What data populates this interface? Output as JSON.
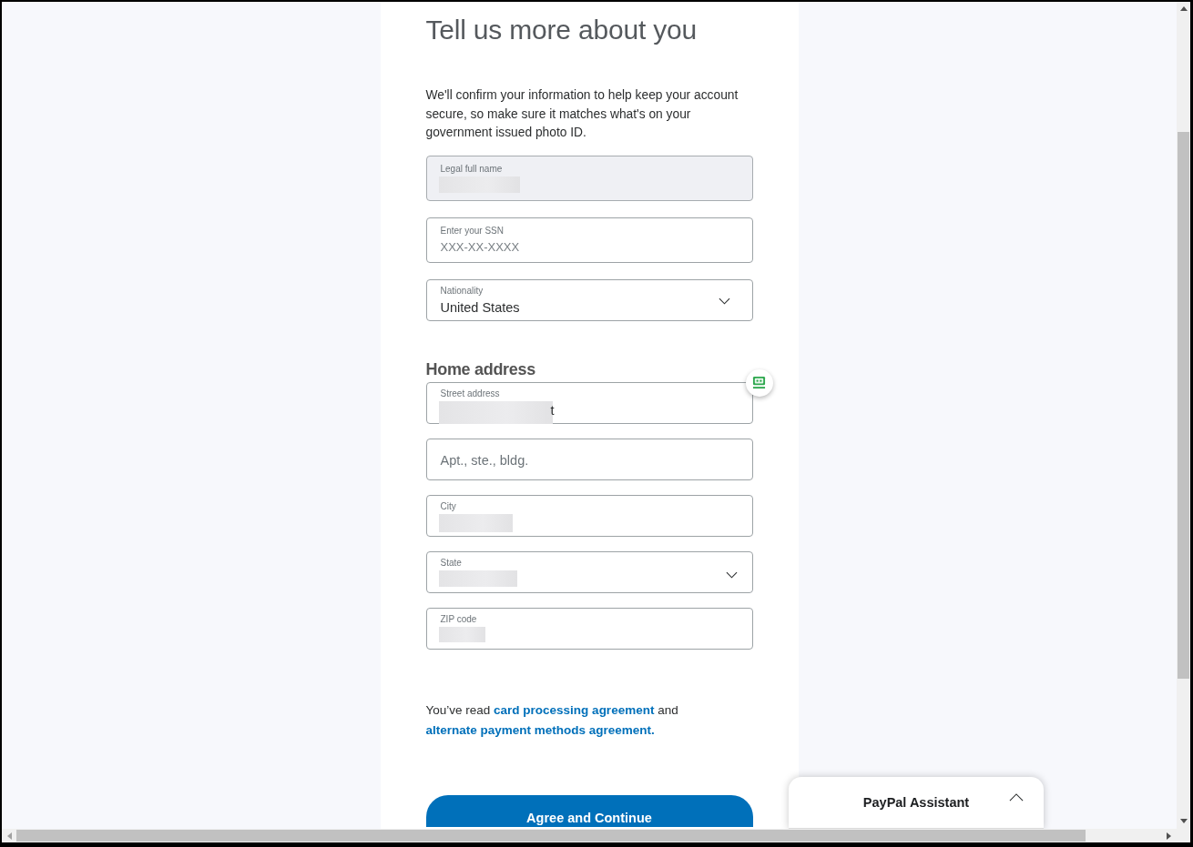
{
  "heading": "Tell us more about you",
  "intro": "We'll confirm your information to help keep your account secure, so make sure it matches what's on your government issued photo ID.",
  "identity_fields": [
    {
      "kind": "text",
      "label": "Legal full name",
      "redacted": true,
      "disabled": true
    },
    {
      "kind": "text",
      "label": "Enter your SSN",
      "placeholder": "XXX-XX-XXXX",
      "redacted": false,
      "disabled": false
    },
    {
      "kind": "select",
      "label": "Nationality",
      "value": "United States",
      "redacted": false,
      "disabled": false
    }
  ],
  "home_address": {
    "title": "Home address",
    "fields": [
      {
        "kind": "text",
        "label": "Street address",
        "value": "t",
        "redacted": true,
        "disabled": false,
        "autofill_badge": true
      },
      {
        "kind": "text",
        "placeholder": "Apt., ste., bldg.",
        "redacted": false,
        "disabled": false,
        "autofill_badge": false
      },
      {
        "kind": "text",
        "label": "City",
        "redacted": true,
        "disabled": false,
        "autofill_badge": false
      },
      {
        "kind": "select",
        "label": "State",
        "redacted": true,
        "disabled": false,
        "autofill_badge": false
      },
      {
        "kind": "text",
        "label": "ZIP code",
        "redacted": true,
        "disabled": false,
        "autofill_badge": false
      }
    ]
  },
  "agreement": [
    {
      "kind": "text",
      "text": "You’ve read"
    },
    {
      "kind": "link",
      "text": "card processing agreement"
    },
    {
      "kind": "text",
      "text": "and"
    },
    {
      "kind": "link",
      "text": "alternate payment methods agreement."
    }
  ],
  "primary_button": "Agree and Continue",
  "assistant": {
    "title": "PayPal Assistant",
    "expanded": false
  }
}
